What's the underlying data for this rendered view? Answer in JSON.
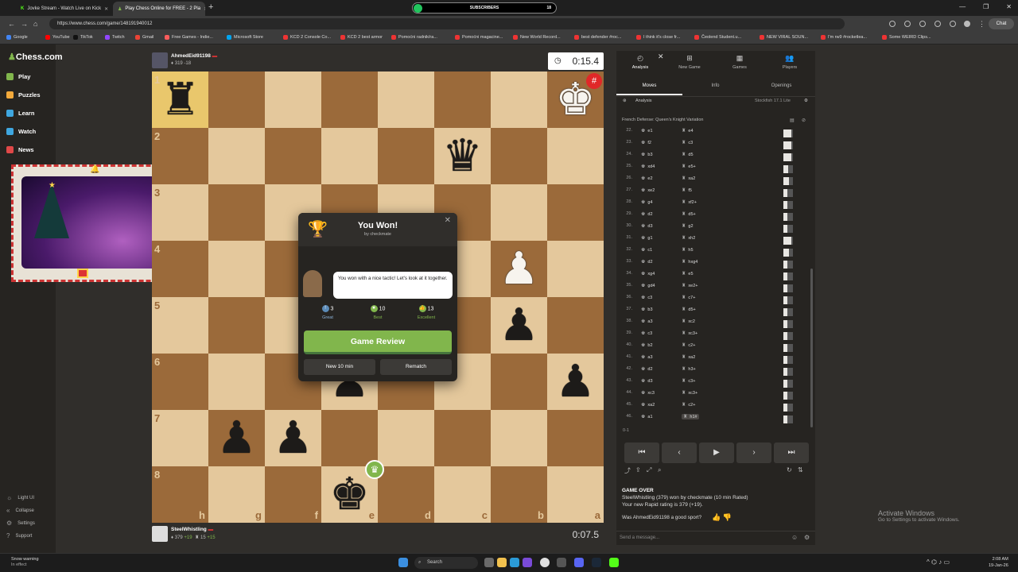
{
  "browser": {
    "tabs": [
      {
        "label": "Jovke Stream - Watch Live on Kick",
        "active": false
      },
      {
        "label": "Play Chess Online for FREE - 2 Pla",
        "active": true
      }
    ],
    "subscribers": {
      "label": "SUBSCRIBERS",
      "count": "18"
    },
    "url": "https://www.chess.com/game/148191940012",
    "chat_label": "Chat",
    "bookmarks": [
      "Google",
      "YouTube",
      "TikTok",
      "Twitch",
      "Gmail",
      "Free Games - Indie...",
      "Microsoft Store",
      "KCD 2 Console Co...",
      "KCD 2 best armor",
      "Pomoćni radnik/ra...",
      "Pomoćni magacine...",
      "New World Record...",
      "best defender #roc...",
      "I think it's close fr...",
      "Čeolend Student.u...",
      "NEW VIRAL SOUN...",
      "I'm rw9 #rocketlea...",
      "Some WEIRD Clips..."
    ]
  },
  "sidebar": {
    "logo": "Chess.com",
    "nav": [
      {
        "label": "Play",
        "icon": "play-icon",
        "color": "#81b64c"
      },
      {
        "label": "Puzzles",
        "icon": "puzzle-icon",
        "color": "#f2a93b"
      },
      {
        "label": "Learn",
        "icon": "learn-icon",
        "color": "#3fa7e0"
      },
      {
        "label": "Watch",
        "icon": "watch-icon",
        "color": "#3fa7e0"
      },
      {
        "label": "News",
        "icon": "news-icon",
        "color": "#e04848"
      }
    ],
    "bottom": [
      {
        "label": "Light UI",
        "icon": "sun-icon"
      },
      {
        "label": "Collapse",
        "icon": "collapse-icon"
      },
      {
        "label": "Settings",
        "icon": "gear-icon"
      },
      {
        "label": "Support",
        "icon": "help-icon"
      }
    ]
  },
  "top_player": {
    "name": "AhmedEid91198",
    "rating": "319",
    "delta": "-18",
    "clock": "0:15.4"
  },
  "bottom_player": {
    "name": "SteelWhistling",
    "rating": "379",
    "delta": "+19",
    "puzzle_rating": "15",
    "puzzle_delta": "+15",
    "clock": "0:07.5"
  },
  "board": {
    "rank_labels": [
      "1",
      "2",
      "3",
      "4",
      "5",
      "6",
      "7",
      "8"
    ],
    "file_labels": [
      "h",
      "g",
      "f",
      "e",
      "d",
      "c",
      "b",
      "a"
    ],
    "highlight": [
      [
        0,
        0
      ]
    ],
    "pieces": [
      {
        "r": 0,
        "c": 0,
        "p": "♜",
        "color": "b"
      },
      {
        "r": 0,
        "c": 7,
        "p": "♚",
        "color": "w",
        "badge": "checkmate"
      },
      {
        "r": 1,
        "c": 5,
        "p": "♛",
        "color": "b"
      },
      {
        "r": 3,
        "c": 6,
        "p": "♟",
        "color": "w"
      },
      {
        "r": 4,
        "c": 6,
        "p": "♟",
        "color": "b"
      },
      {
        "r": 5,
        "c": 3,
        "p": "♟",
        "color": "b"
      },
      {
        "r": 5,
        "c": 7,
        "p": "♟",
        "color": "b"
      },
      {
        "r": 6,
        "c": 1,
        "p": "♟",
        "color": "b"
      },
      {
        "r": 6,
        "c": 2,
        "p": "♟",
        "color": "b"
      },
      {
        "r": 7,
        "c": 3,
        "p": "♚",
        "color": "b",
        "badge": "winner"
      }
    ]
  },
  "modal": {
    "title": "You Won!",
    "subtitle": "by checkmate",
    "coach_message": "You won with a nice tactic! Let's look at it together.",
    "stats": [
      {
        "count": "3",
        "label": "Great",
        "color": "#5b8bb8"
      },
      {
        "count": "10",
        "label": "Best",
        "color": "#81b64c"
      },
      {
        "count": "13",
        "label": "Excellent",
        "color": "#81b64c"
      }
    ],
    "review_button": "Game Review",
    "new_game_button": "New 10 min",
    "rematch_button": "Rematch"
  },
  "right_panel": {
    "tabs": [
      {
        "label": "Analysis",
        "icon": "analysis-icon"
      },
      {
        "label": "New Game",
        "icon": "plus-icon"
      },
      {
        "label": "Games",
        "icon": "games-icon"
      },
      {
        "label": "Players",
        "icon": "players-icon"
      }
    ],
    "subtabs": [
      "Moves",
      "Info",
      "Openings"
    ],
    "analysis_label": "Analysis",
    "engine_label": "Stockfish 17.1 Lite",
    "opening": "French Defense: Queen's Knight Variation",
    "moves": [
      {
        "n": "22.",
        "w": "e1",
        "b": "e4",
        "wv": 0.8,
        "bv": 0.8
      },
      {
        "n": "23.",
        "w": "f2",
        "b": "c3",
        "wv": 0.8,
        "bv": 0.7
      },
      {
        "n": "24.",
        "w": "b3",
        "b": "d5",
        "wv": 0.8,
        "bv": 0.6
      },
      {
        "n": "25.",
        "w": "xd4",
        "b": "e5+",
        "wv": 0.5,
        "bv": 0.5
      },
      {
        "n": "26.",
        "w": "e2",
        "b": "xa2",
        "wv": 0.6,
        "bv": 0.5
      },
      {
        "n": "27.",
        "w": "xe2",
        "b": "f5",
        "wv": 0.4,
        "bv": 0.4
      },
      {
        "n": "28.",
        "w": "g4",
        "b": "xf2+",
        "wv": 0.4,
        "bv": 0.4
      },
      {
        "n": "29.",
        "w": "d2",
        "b": "d5+",
        "wv": 0.4,
        "bv": 0.4
      },
      {
        "n": "30.",
        "w": "d3",
        "b": "g2",
        "wv": 0.4,
        "bv": 0.4
      },
      {
        "n": "31.",
        "w": "g1",
        "b": "xh2",
        "wv": 0.8,
        "bv": 0.6
      },
      {
        "n": "32.",
        "w": "c1",
        "b": "h5",
        "wv": 0.6,
        "bv": 0.5
      },
      {
        "n": "33.",
        "w": "d2",
        "b": "hxg4",
        "wv": 0.4,
        "bv": 0.4
      },
      {
        "n": "34.",
        "w": "xg4",
        "b": "e5",
        "wv": 0.4,
        "bv": 0.4
      },
      {
        "n": "35.",
        "w": "gd4",
        "b": "xe2+",
        "wv": 0.4,
        "bv": 0.4
      },
      {
        "n": "36.",
        "w": "c3",
        "b": "c7+",
        "wv": 0.4,
        "bv": 0.4
      },
      {
        "n": "37.",
        "w": "b3",
        "b": "d5+",
        "wv": 0.4,
        "bv": 0.4
      },
      {
        "n": "38.",
        "w": "a3",
        "b": "xc2",
        "wv": 0.4,
        "bv": 0.4
      },
      {
        "n": "39.",
        "w": "c3",
        "b": "xc3+",
        "wv": 0.4,
        "bv": 0.4
      },
      {
        "n": "40.",
        "w": "b2",
        "b": "c2+",
        "wv": 0.4,
        "bv": 0.4
      },
      {
        "n": "41.",
        "w": "a3",
        "b": "xa2",
        "wv": 0.4,
        "bv": 0.4
      },
      {
        "n": "42.",
        "w": "d2",
        "b": "h3+",
        "wv": 0.4,
        "bv": 0.4
      },
      {
        "n": "43.",
        "w": "d3",
        "b": "c3+",
        "wv": 0.4,
        "bv": 0.4
      },
      {
        "n": "44.",
        "w": "xc3",
        "b": "xc3+",
        "wv": 0.4,
        "bv": 0.4
      },
      {
        "n": "45.",
        "w": "xa2",
        "b": "c2+",
        "wv": 0.4,
        "bv": 0.4
      },
      {
        "n": "46.",
        "w": "a1",
        "b": "h1#",
        "wv": 0.4,
        "bv": 0.4
      }
    ],
    "result": "0-1",
    "game_over": "GAME OVER",
    "game_over_line": "SteelWhistling (379) won by checkmate (10 min Rated)",
    "rating_line": "Your new Rapid rating is 379 (+19).",
    "sport_question": "Was AhmedEid91198 a good sport?",
    "message_placeholder": "Send a message..."
  },
  "windows_activation": {
    "line1": "Activate Windows",
    "line2": "Go to Settings to activate Windows."
  },
  "taskbar": {
    "weather_title": "Snow warning",
    "weather_sub": "In effect",
    "search": "Search",
    "time": "2:08 AM",
    "date": "19-Jan-26"
  }
}
